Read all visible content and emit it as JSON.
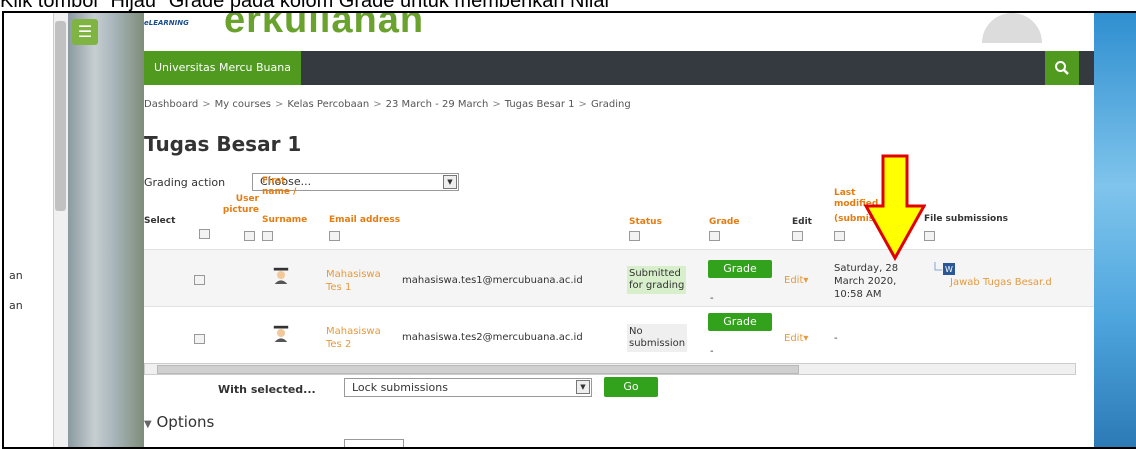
{
  "caption": "Klik tombol \"Hijau\" Grade pada kolom Grade untuk memberikan Nilai",
  "left_strip": {
    "item1": "an",
    "item2": "an"
  },
  "header": {
    "logo_text": "eLEARNING",
    "title_partial": "erkuliahan",
    "brand": "Universitas Mercu Buana",
    "search_icon": "search-icon",
    "menu_icon": "hamburger-icon"
  },
  "breadcrumb": [
    "Dashboard",
    "My courses",
    "Kelas Percobaan",
    "23 March - 29 March",
    "Tugas Besar 1",
    "Grading"
  ],
  "page": {
    "title": "Tugas Besar 1",
    "grading_action_label": "Grading action",
    "grading_action_value": "Choose..."
  },
  "table": {
    "headers": {
      "select": "Select",
      "user_picture_1": "User",
      "user_picture_2": "picture",
      "first_name_1": "First",
      "first_name_2": "name /",
      "first_name_3": "Surname",
      "email": "Email address",
      "status": "Status",
      "grade": "Grade",
      "edit": "Edit",
      "last_mod_1": "Last",
      "last_mod_2": "modified",
      "last_mod_3": "(submission)",
      "file_sub": "File submissions"
    },
    "rows": [
      {
        "name_1": "Mahasiswa",
        "name_2": "Tes 1",
        "email": "mahasiswa.tes1@mercubuana.ac.id",
        "status_1": "Submitted",
        "status_2": "for grading",
        "grade_btn": "Grade",
        "grade_dash": "-",
        "edit": "Edit",
        "last_1": "Saturday, 28",
        "last_2": "March 2020,",
        "last_3": "10:58 AM",
        "file": "Jawab Tugas Besar.d"
      },
      {
        "name_1": "Mahasiswa",
        "name_2": "Tes 2",
        "email": "mahasiswa.tes2@mercubuana.ac.id",
        "status_1": "No",
        "status_2": "submission",
        "grade_btn": "Grade",
        "grade_dash": "-",
        "edit": "Edit",
        "last_1": "-",
        "file": ""
      }
    ]
  },
  "bulk": {
    "with_selected": "With selected...",
    "action_value": "Lock submissions",
    "go": "Go"
  },
  "options_label": "Options",
  "colors": {
    "green": "#4f9a1f",
    "button_green": "#32a11b",
    "nav": "#343a40",
    "link": "#e59a3e",
    "arrow": "#ffff00"
  }
}
